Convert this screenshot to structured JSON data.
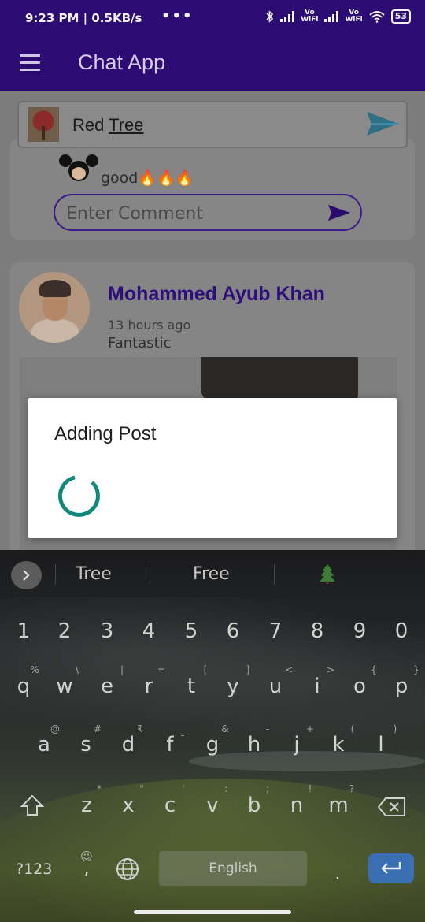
{
  "status_bar": {
    "time": "9:23 PM | 0.5KB/s",
    "more": "•••",
    "vowifi_1": "Vo\nWiFi",
    "vowifi_2": "Vo\nWiFi",
    "battery": "53"
  },
  "app_bar": {
    "title": "Chat App"
  },
  "composer": {
    "text_plain": "Red ",
    "text_underlined": "Tree"
  },
  "comment_card": {
    "comment_text": "good🔥🔥🔥",
    "input_placeholder": "Enter Comment"
  },
  "post_card": {
    "author": "Mohammed Ayub Khan",
    "time": "13 hours ago",
    "caption": "Fantastic"
  },
  "dialog": {
    "title": "Adding Post"
  },
  "keyboard": {
    "suggestions": [
      "Tree",
      "Free"
    ],
    "suggestion_emoji": "🌲",
    "number_row": [
      "1",
      "2",
      "3",
      "4",
      "5",
      "6",
      "7",
      "8",
      "9",
      "0"
    ],
    "row1": [
      "q",
      "w",
      "e",
      "r",
      "t",
      "y",
      "u",
      "i",
      "o",
      "p"
    ],
    "row1_hints": [
      "%",
      "\\",
      "|",
      "=",
      "[",
      "]",
      "<",
      ">",
      "{",
      "}"
    ],
    "row2": [
      "a",
      "s",
      "d",
      "f",
      "g",
      "h",
      "j",
      "k",
      "l"
    ],
    "row2_hints": [
      "@",
      "#",
      "₹",
      "-",
      "&",
      "-",
      "+",
      "(",
      ")"
    ],
    "row3": [
      "z",
      "x",
      "c",
      "v",
      "b",
      "n",
      "m"
    ],
    "row3_hints": [
      "*",
      "\"",
      "'",
      ":",
      ";",
      "!",
      "?"
    ],
    "symbols_key": "?123",
    "emoji_key": "☺",
    "comma_key": ",",
    "space_label": "English",
    "period_key": "."
  },
  "colors": {
    "primary_dimmed": "#2c0b73",
    "accent_spinner": "#0f8a7a",
    "enter_key": "#3b6fb3"
  }
}
